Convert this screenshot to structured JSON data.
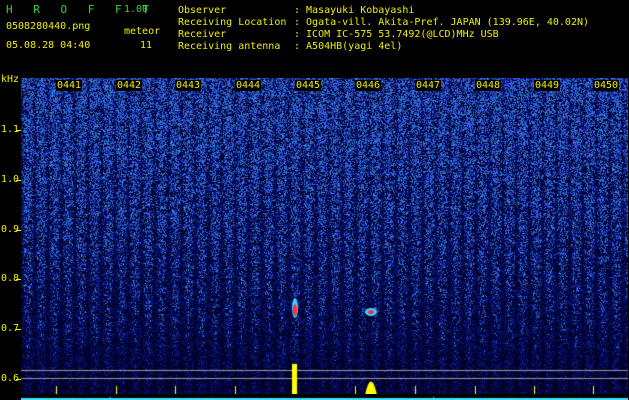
{
  "header": {
    "app_title": "H R O F F T",
    "version": "1.00",
    "filename": "0508280440.png",
    "datetime": "05.08.28 04:40",
    "mode_label": "meteor",
    "meteor_count": "11"
  },
  "info": [
    {
      "key": "Observer",
      "value": ": Masayuki Kobayashi"
    },
    {
      "key": "Receiving Location",
      "value": ": Ogata-vill. Akita-Pref. JAPAN (139.96E, 40.02N)"
    },
    {
      "key": "Receiver",
      "value": ": ICOM IC-575 53.7492(@LCD)MHz USB"
    },
    {
      "key": "Receiving antenna",
      "value": ": A504HB(yagi 4el)"
    }
  ],
  "axis": {
    "unit_label": "kHz",
    "y_ticks": [
      "1.1",
      "1.0",
      "0.9",
      "0.8",
      "0.7",
      "0.6"
    ],
    "time_labels": [
      "0441",
      "0442",
      "0443",
      "0444",
      "0445",
      "0446",
      "0447",
      "0448",
      "0449",
      "0450"
    ]
  },
  "colors": {
    "background": "#000000",
    "header_green": "#33d633",
    "label_yellow": "#f0f000",
    "noise_blue": "#2a4fd0",
    "echo_red": "#ff2a3a",
    "echo_yellow": "#ffff00",
    "baseline_cyan": "#40e0ff"
  }
}
